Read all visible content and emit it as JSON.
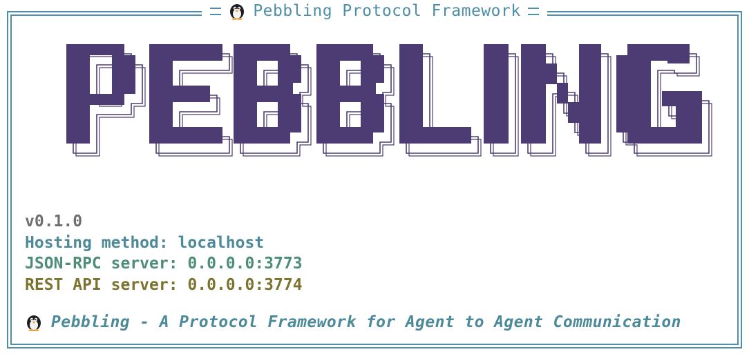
{
  "window": {
    "title": "Pebbling Protocol Framework",
    "title_icon": "penguin-icon"
  },
  "banner": {
    "logo_text": "PEBBLING",
    "logo_color": "#4d3c74"
  },
  "info": {
    "version": "v0.1.0",
    "hosting": "Hosting method: localhost",
    "jsonrpc": "JSON-RPC server: 0.0.0.0:3773",
    "rest": "REST API server: 0.0.0.0:3774"
  },
  "footer": {
    "tagline": "Pebbling - A Protocol Framework for Agent to Agent Communication",
    "icon": "penguin-icon"
  },
  "colors": {
    "border": "#4d8fa8",
    "version": "#6f6f6f",
    "hosting": "#4d8a99",
    "jsonrpc": "#4d8d7a",
    "rest": "#7a7430"
  }
}
